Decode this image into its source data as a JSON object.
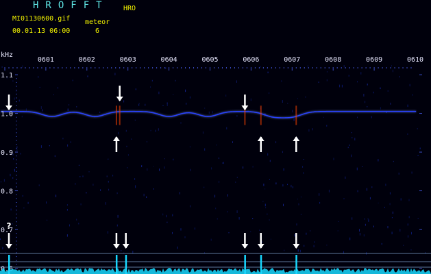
{
  "header": {
    "app_title": "HROFFT",
    "mode": "HRO",
    "file_name": "MI01130600.gif",
    "date_time": "00.01.13 06:00",
    "event_label": "meteor",
    "event_count": "6"
  },
  "chart_data": {
    "type": "heatmap",
    "title": "",
    "y_unit_label": "kHz",
    "x_tick_labels": [
      "0601",
      "0602",
      "0603",
      "0604",
      "0605",
      "0606",
      "0607",
      "0608",
      "0609",
      "0610"
    ],
    "y_tick_labels": [
      "1.1",
      "1.0",
      "0.9",
      "0.8",
      "0.7",
      "0.6"
    ],
    "y_ticks": [
      1.1,
      1.0,
      0.9,
      0.8,
      0.7,
      0.6
    ],
    "xlim": [
      0,
      10
    ],
    "ylim": [
      0.585,
      1.155
    ],
    "baseline_signal_khz": 1.005,
    "meteor_pings_minute": [
      2.72,
      6.24,
      7.1
    ],
    "meteor_pings_pointed_from": [
      "below",
      "below",
      "below"
    ],
    "meteor_candidates_minute": [
      0.1,
      2.8,
      5.85
    ],
    "meteor_candidates_pointed_from": [
      "above",
      "above",
      "above"
    ],
    "lower_markers_minute": [
      0.1,
      2.72,
      2.95,
      5.85,
      6.24,
      7.1
    ],
    "uncertain_marker_label": "?",
    "uncertain_marker_minute": 0.1,
    "colors": {
      "background": "#00000c",
      "carrier": "#2a43ff",
      "carrier_glow": "#7f9dff",
      "ping": "#ff4400",
      "histogram": "#18d8ff",
      "guide_line": "#9ec8ff",
      "marker": "#ffffff",
      "axis_text": "#e8e8ff"
    }
  }
}
